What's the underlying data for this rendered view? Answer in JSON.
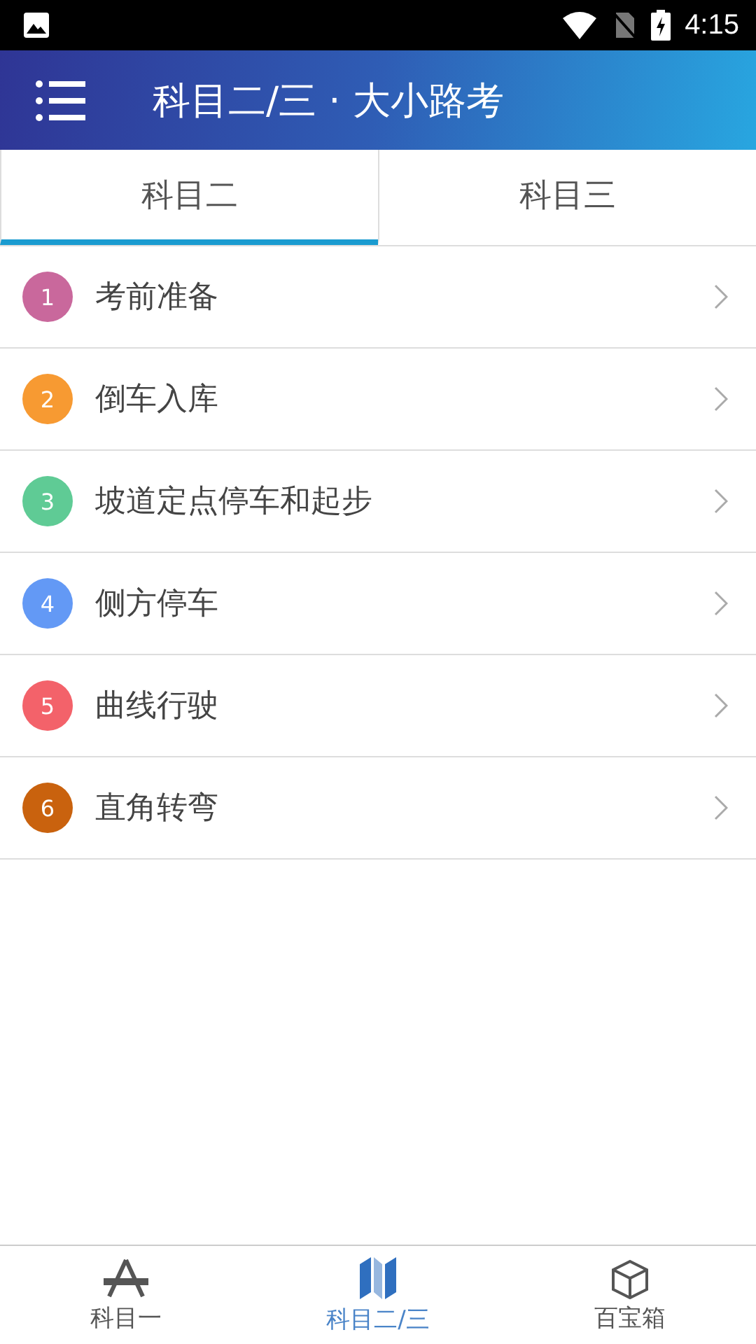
{
  "status_bar": {
    "time": "4:15"
  },
  "app_bar": {
    "title": "科目二/三 · 大小路考"
  },
  "tabs": [
    {
      "label": "科目二",
      "selected": true
    },
    {
      "label": "科目三",
      "selected": false
    }
  ],
  "items": [
    {
      "number": "1",
      "label": "考前准备",
      "color": "#c9689c"
    },
    {
      "number": "2",
      "label": "倒车入库",
      "color": "#f79a32"
    },
    {
      "number": "3",
      "label": "坡道定点停车和起步",
      "color": "#5fcb95"
    },
    {
      "number": "4",
      "label": "侧方停车",
      "color": "#6399f5"
    },
    {
      "number": "5",
      "label": "曲线行驶",
      "color": "#f3626a"
    },
    {
      "number": "6",
      "label": "直角转弯",
      "color": "#c9620e"
    }
  ],
  "bottom_nav": [
    {
      "label": "科目一",
      "kind": "compass",
      "selected": false
    },
    {
      "label": "科目二/三",
      "kind": "map",
      "selected": true
    },
    {
      "label": "百宝箱",
      "kind": "box",
      "selected": false
    }
  ]
}
